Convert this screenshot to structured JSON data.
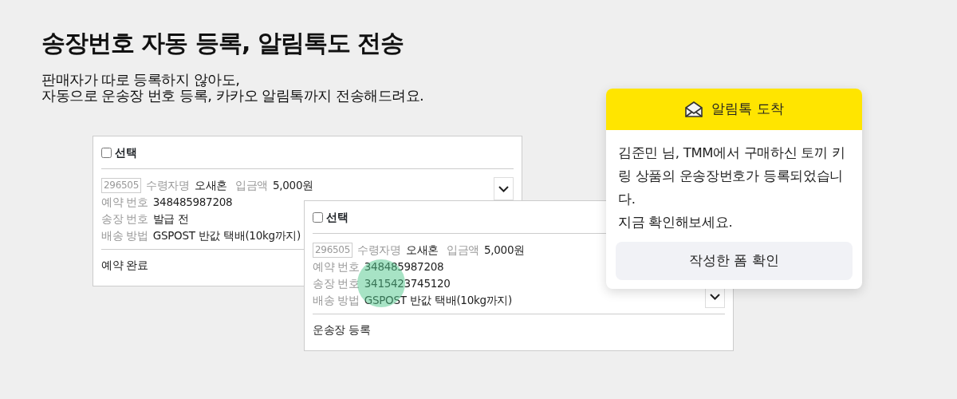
{
  "headline": "송장번호 자동 등록, 알림톡도 전송",
  "subtitle": [
    "판매자가 따로 등록하지 않아도,",
    "자동으로 운송장 번호 등록, 카카오 알림톡까지 전송해드려요."
  ],
  "order_cards": [
    {
      "select": {
        "label": "선택",
        "checked": false
      },
      "order_code": "296505",
      "lines": [
        [
          {
            "label": "수령자명",
            "value": "오새혼"
          },
          {
            "label": "입금액",
            "value": "5,000원"
          }
        ],
        [
          {
            "label": "예약 번호",
            "value": "348485987208"
          }
        ],
        [
          {
            "label": "송장 번호",
            "value": "발급 전"
          }
        ],
        [
          {
            "label": "배송 방법",
            "value": "GSPOST 반값 택배(10kg까지)"
          }
        ]
      ],
      "status": "예약 완료",
      "tapped": false
    },
    {
      "select": {
        "label": "선택",
        "checked": false
      },
      "order_code": "296505",
      "lines": [
        [
          {
            "label": "수령자명",
            "value": "오새혼"
          },
          {
            "label": "입금액",
            "value": "5,000원"
          }
        ],
        [
          {
            "label": "예약 번호",
            "value": "348485987208"
          }
        ],
        [
          {
            "label": "송장 번호",
            "value": "3415423745120"
          }
        ],
        [
          {
            "label": "배송 방법",
            "value": "GSPOST 반값 택배(10kg까지)"
          }
        ]
      ],
      "status": "운송장 등록",
      "tapped": true
    }
  ],
  "notification": {
    "title": "알림톡 도착",
    "message": [
      "김준민 님, TMM에서 구매하신 토끼 키링 상품의 운송장번호가 등록되었습니다.",
      "지금 확인해보세요."
    ],
    "button": "작성한 폼 확인"
  }
}
